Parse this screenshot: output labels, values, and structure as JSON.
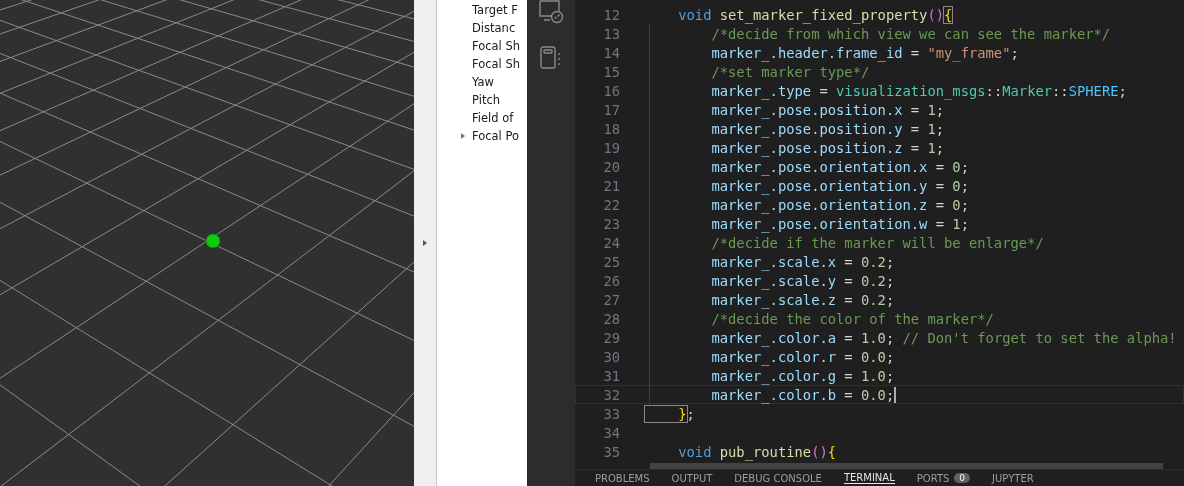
{
  "tree": {
    "items": [
      {
        "label": "Target F",
        "expandable": false
      },
      {
        "label": "Distanc",
        "expandable": false
      },
      {
        "label": "Focal Sh",
        "expandable": false
      },
      {
        "label": "Focal Sh",
        "expandable": false
      },
      {
        "label": "Yaw",
        "expandable": false
      },
      {
        "label": "Pitch",
        "expandable": false
      },
      {
        "label": "Field of",
        "expandable": false
      },
      {
        "label": "Focal Po",
        "expandable": true
      }
    ]
  },
  "editor": {
    "lines": [
      {
        "number": "12",
        "current": false,
        "tokens": [
          {
            "kind": "keyword",
            "text": "    void"
          },
          {
            "kind": "function",
            "text": " set_marker_fixed_property"
          },
          {
            "kind": "paren",
            "text": "()"
          },
          {
            "kind": "brace",
            "text": "{",
            "matched": true
          }
        ]
      },
      {
        "number": "13",
        "current": false,
        "tokens": [
          {
            "kind": "comment",
            "text": "        /*decide from which view we can see the marker*/"
          }
        ]
      },
      {
        "number": "14",
        "current": false,
        "tokens": [
          {
            "kind": "variable",
            "text": "        marker_.header.frame_id"
          },
          {
            "kind": "punct",
            "text": " = "
          },
          {
            "kind": "string",
            "text": "\"my_frame\""
          },
          {
            "kind": "punct",
            "text": ";"
          }
        ]
      },
      {
        "number": "15",
        "current": false,
        "tokens": [
          {
            "kind": "comment",
            "text": "        /*set marker type*/"
          }
        ]
      },
      {
        "number": "16",
        "current": false,
        "tokens": [
          {
            "kind": "variable",
            "text": "        marker_.type"
          },
          {
            "kind": "punct",
            "text": " = "
          },
          {
            "kind": "type",
            "text": "visualization_msgs"
          },
          {
            "kind": "punct",
            "text": "::"
          },
          {
            "kind": "type",
            "text": "Marker"
          },
          {
            "kind": "punct",
            "text": "::"
          },
          {
            "kind": "constant",
            "text": "SPHERE"
          },
          {
            "kind": "punct",
            "text": ";"
          }
        ]
      },
      {
        "number": "17",
        "current": false,
        "tokens": [
          {
            "kind": "variable",
            "text": "        marker_.pose.position.x"
          },
          {
            "kind": "punct",
            "text": " = "
          },
          {
            "kind": "number",
            "text": "1"
          },
          {
            "kind": "punct",
            "text": ";"
          }
        ]
      },
      {
        "number": "18",
        "current": false,
        "tokens": [
          {
            "kind": "variable",
            "text": "        marker_.pose.position.y"
          },
          {
            "kind": "punct",
            "text": " = "
          },
          {
            "kind": "number",
            "text": "1"
          },
          {
            "kind": "punct",
            "text": ";"
          }
        ]
      },
      {
        "number": "19",
        "current": false,
        "tokens": [
          {
            "kind": "variable",
            "text": "        marker_.pose.position.z"
          },
          {
            "kind": "punct",
            "text": " = "
          },
          {
            "kind": "number",
            "text": "1"
          },
          {
            "kind": "punct",
            "text": ";"
          }
        ]
      },
      {
        "number": "20",
        "current": false,
        "tokens": [
          {
            "kind": "variable",
            "text": "        marker_.pose.orientation.x"
          },
          {
            "kind": "punct",
            "text": " = "
          },
          {
            "kind": "number",
            "text": "0"
          },
          {
            "kind": "punct",
            "text": ";"
          }
        ]
      },
      {
        "number": "21",
        "current": false,
        "tokens": [
          {
            "kind": "variable",
            "text": "        marker_.pose.orientation.y"
          },
          {
            "kind": "punct",
            "text": " = "
          },
          {
            "kind": "number",
            "text": "0"
          },
          {
            "kind": "punct",
            "text": ";"
          }
        ]
      },
      {
        "number": "22",
        "current": false,
        "tokens": [
          {
            "kind": "variable",
            "text": "        marker_.pose.orientation.z"
          },
          {
            "kind": "punct",
            "text": " = "
          },
          {
            "kind": "number",
            "text": "0"
          },
          {
            "kind": "punct",
            "text": ";"
          }
        ]
      },
      {
        "number": "23",
        "current": false,
        "tokens": [
          {
            "kind": "variable",
            "text": "        marker_.pose.orientation.w"
          },
          {
            "kind": "punct",
            "text": " = "
          },
          {
            "kind": "number",
            "text": "1"
          },
          {
            "kind": "punct",
            "text": ";"
          }
        ]
      },
      {
        "number": "24",
        "current": false,
        "tokens": [
          {
            "kind": "comment",
            "text": "        /*decide if the marker will be enlarge*/"
          }
        ]
      },
      {
        "number": "25",
        "current": false,
        "tokens": [
          {
            "kind": "variable",
            "text": "        marker_.scale.x"
          },
          {
            "kind": "punct",
            "text": " = "
          },
          {
            "kind": "number",
            "text": "0.2"
          },
          {
            "kind": "punct",
            "text": ";"
          }
        ]
      },
      {
        "number": "26",
        "current": false,
        "tokens": [
          {
            "kind": "variable",
            "text": "        marker_.scale.y"
          },
          {
            "kind": "punct",
            "text": " = "
          },
          {
            "kind": "number",
            "text": "0.2"
          },
          {
            "kind": "punct",
            "text": ";"
          }
        ]
      },
      {
        "number": "27",
        "current": false,
        "tokens": [
          {
            "kind": "variable",
            "text": "        marker_.scale.z"
          },
          {
            "kind": "punct",
            "text": " = "
          },
          {
            "kind": "number",
            "text": "0.2"
          },
          {
            "kind": "punct",
            "text": ";"
          }
        ]
      },
      {
        "number": "28",
        "current": false,
        "tokens": [
          {
            "kind": "comment",
            "text": "        /*decide the color of the marker*/"
          }
        ]
      },
      {
        "number": "29",
        "current": false,
        "tokens": [
          {
            "kind": "variable",
            "text": "        marker_.color.a"
          },
          {
            "kind": "punct",
            "text": " = "
          },
          {
            "kind": "number",
            "text": "1.0"
          },
          {
            "kind": "punct",
            "text": "; "
          },
          {
            "kind": "comment",
            "text": "// Don't forget to set the alpha!"
          }
        ]
      },
      {
        "number": "30",
        "current": false,
        "tokens": [
          {
            "kind": "variable",
            "text": "        marker_.color.r"
          },
          {
            "kind": "punct",
            "text": " = "
          },
          {
            "kind": "number",
            "text": "0.0"
          },
          {
            "kind": "punct",
            "text": ";"
          }
        ]
      },
      {
        "number": "31",
        "current": false,
        "tokens": [
          {
            "kind": "variable",
            "text": "        marker_.color.g"
          },
          {
            "kind": "punct",
            "text": " = "
          },
          {
            "kind": "number",
            "text": "1.0"
          },
          {
            "kind": "punct",
            "text": ";"
          }
        ]
      },
      {
        "number": "32",
        "current": true,
        "tokens": [
          {
            "kind": "variable",
            "text": "        marker_.color.b"
          },
          {
            "kind": "punct",
            "text": " = "
          },
          {
            "kind": "number",
            "text": "0.0"
          },
          {
            "kind": "punct",
            "text": ";"
          }
        ]
      },
      {
        "number": "33",
        "current": false,
        "tokens": [
          {
            "kind": "brace",
            "text": "    }",
            "matched": true
          },
          {
            "kind": "punct",
            "text": ";"
          }
        ]
      },
      {
        "number": "34",
        "current": false
      },
      {
        "number": "35",
        "current": false,
        "tokens": [
          {
            "kind": "keyword",
            "text": "    void"
          },
          {
            "kind": "function",
            "text": " pub_routine"
          },
          {
            "kind": "paren",
            "text": "()"
          },
          {
            "kind": "brace",
            "text": "{"
          }
        ]
      }
    ]
  },
  "panel_tabs": [
    {
      "label": "PROBLEMS",
      "selected": false
    },
    {
      "label": "OUTPUT",
      "selected": false
    },
    {
      "label": "DEBUG CONSOLE",
      "selected": false
    },
    {
      "label": "TERMINAL",
      "selected": true
    },
    {
      "label": "PORTS",
      "selected": false,
      "badge": "0"
    },
    {
      "label": "JUPYTER",
      "selected": false
    }
  ]
}
